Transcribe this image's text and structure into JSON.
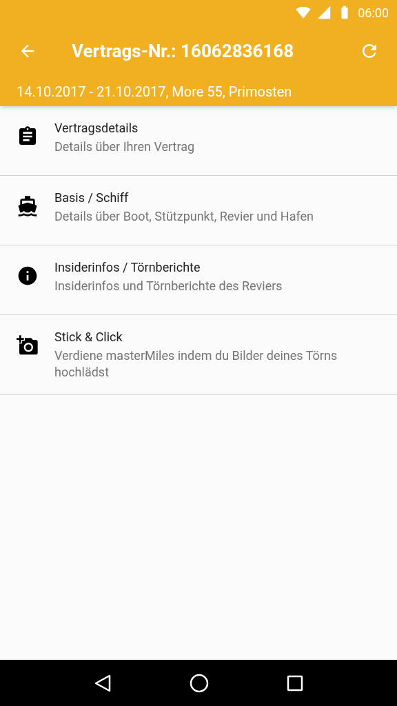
{
  "status_bar": {
    "time": "06:00"
  },
  "toolbar": {
    "title": "Vertrags-Nr.: 16062836168",
    "subtitle": "14.10.2017 - 21.10.2017, More 55, Primosten"
  },
  "items": [
    {
      "title": "Vertragsdetails",
      "subtitle": "Details über Ihren Vertrag"
    },
    {
      "title": "Basis / Schiff",
      "subtitle": "Details über Boot, Stützpunkt, Revier und Hafen"
    },
    {
      "title": "Insiderinfos / Törnberichte",
      "subtitle": "Insiderinfos und Törnberichte des Reviers"
    },
    {
      "title": "Stick & Click",
      "subtitle": "Verdiene masterMiles indem du Bilder deines Törns hochlädst"
    }
  ]
}
